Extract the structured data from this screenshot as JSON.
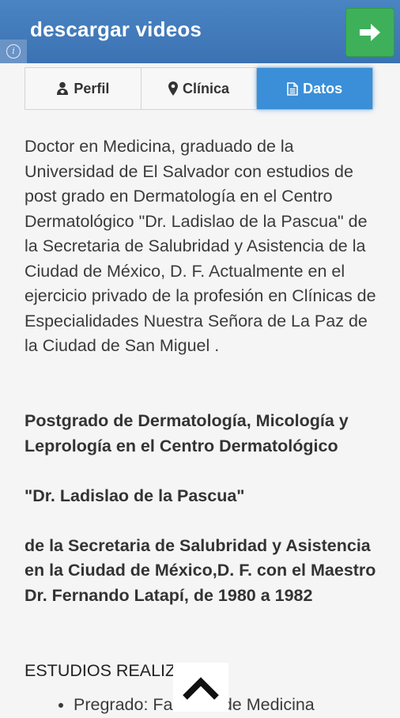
{
  "banner": {
    "title": "descargar videos",
    "info_glyph": "i",
    "go_button_icon": "arrow-right-icon",
    "colors": {
      "background": "#3f79b9",
      "go_button": "#3eb05a"
    }
  },
  "tabs": [
    {
      "label": "Perfil",
      "icon": "user-md-icon",
      "active": false
    },
    {
      "label": "Clínica",
      "icon": "map-marker-icon",
      "active": false
    },
    {
      "label": "Datos",
      "icon": "file-icon",
      "active": true
    }
  ],
  "content": {
    "paragraph": "Doctor en Medicina, graduado de la Universidad de El Salvador con estudios de post grado en Dermatología en el Centro Dermatológico \"Dr. Ladislao de la Pascua\" de la Secretaria de Salubridad y Asistencia de la Ciudad de México, D. F.  Actualmente en el ejercicio privado de la profesión en Clínicas de Especialidades Nuestra Señora de La Paz de la Ciudad de San Miguel .",
    "bold_lines": [
      "Postgrado de Dermatología, Micología y Leprología en el Centro Dermatológico",
      "\"Dr. Ladislao de la Pascua\"",
      "de la Secretaria de Salubridad y Asistencia en la Ciudad de México,D. F. con el Maestro Dr. Fernando Latapí, de 1980 a 1982"
    ],
    "heading": "ESTUDIOS REALIZADOS",
    "list_items": [
      "Pregrado: Facultad de Medicina"
    ]
  },
  "scroll_top_icon": "chevron-up-icon",
  "accent_color": "#3a8fd8"
}
